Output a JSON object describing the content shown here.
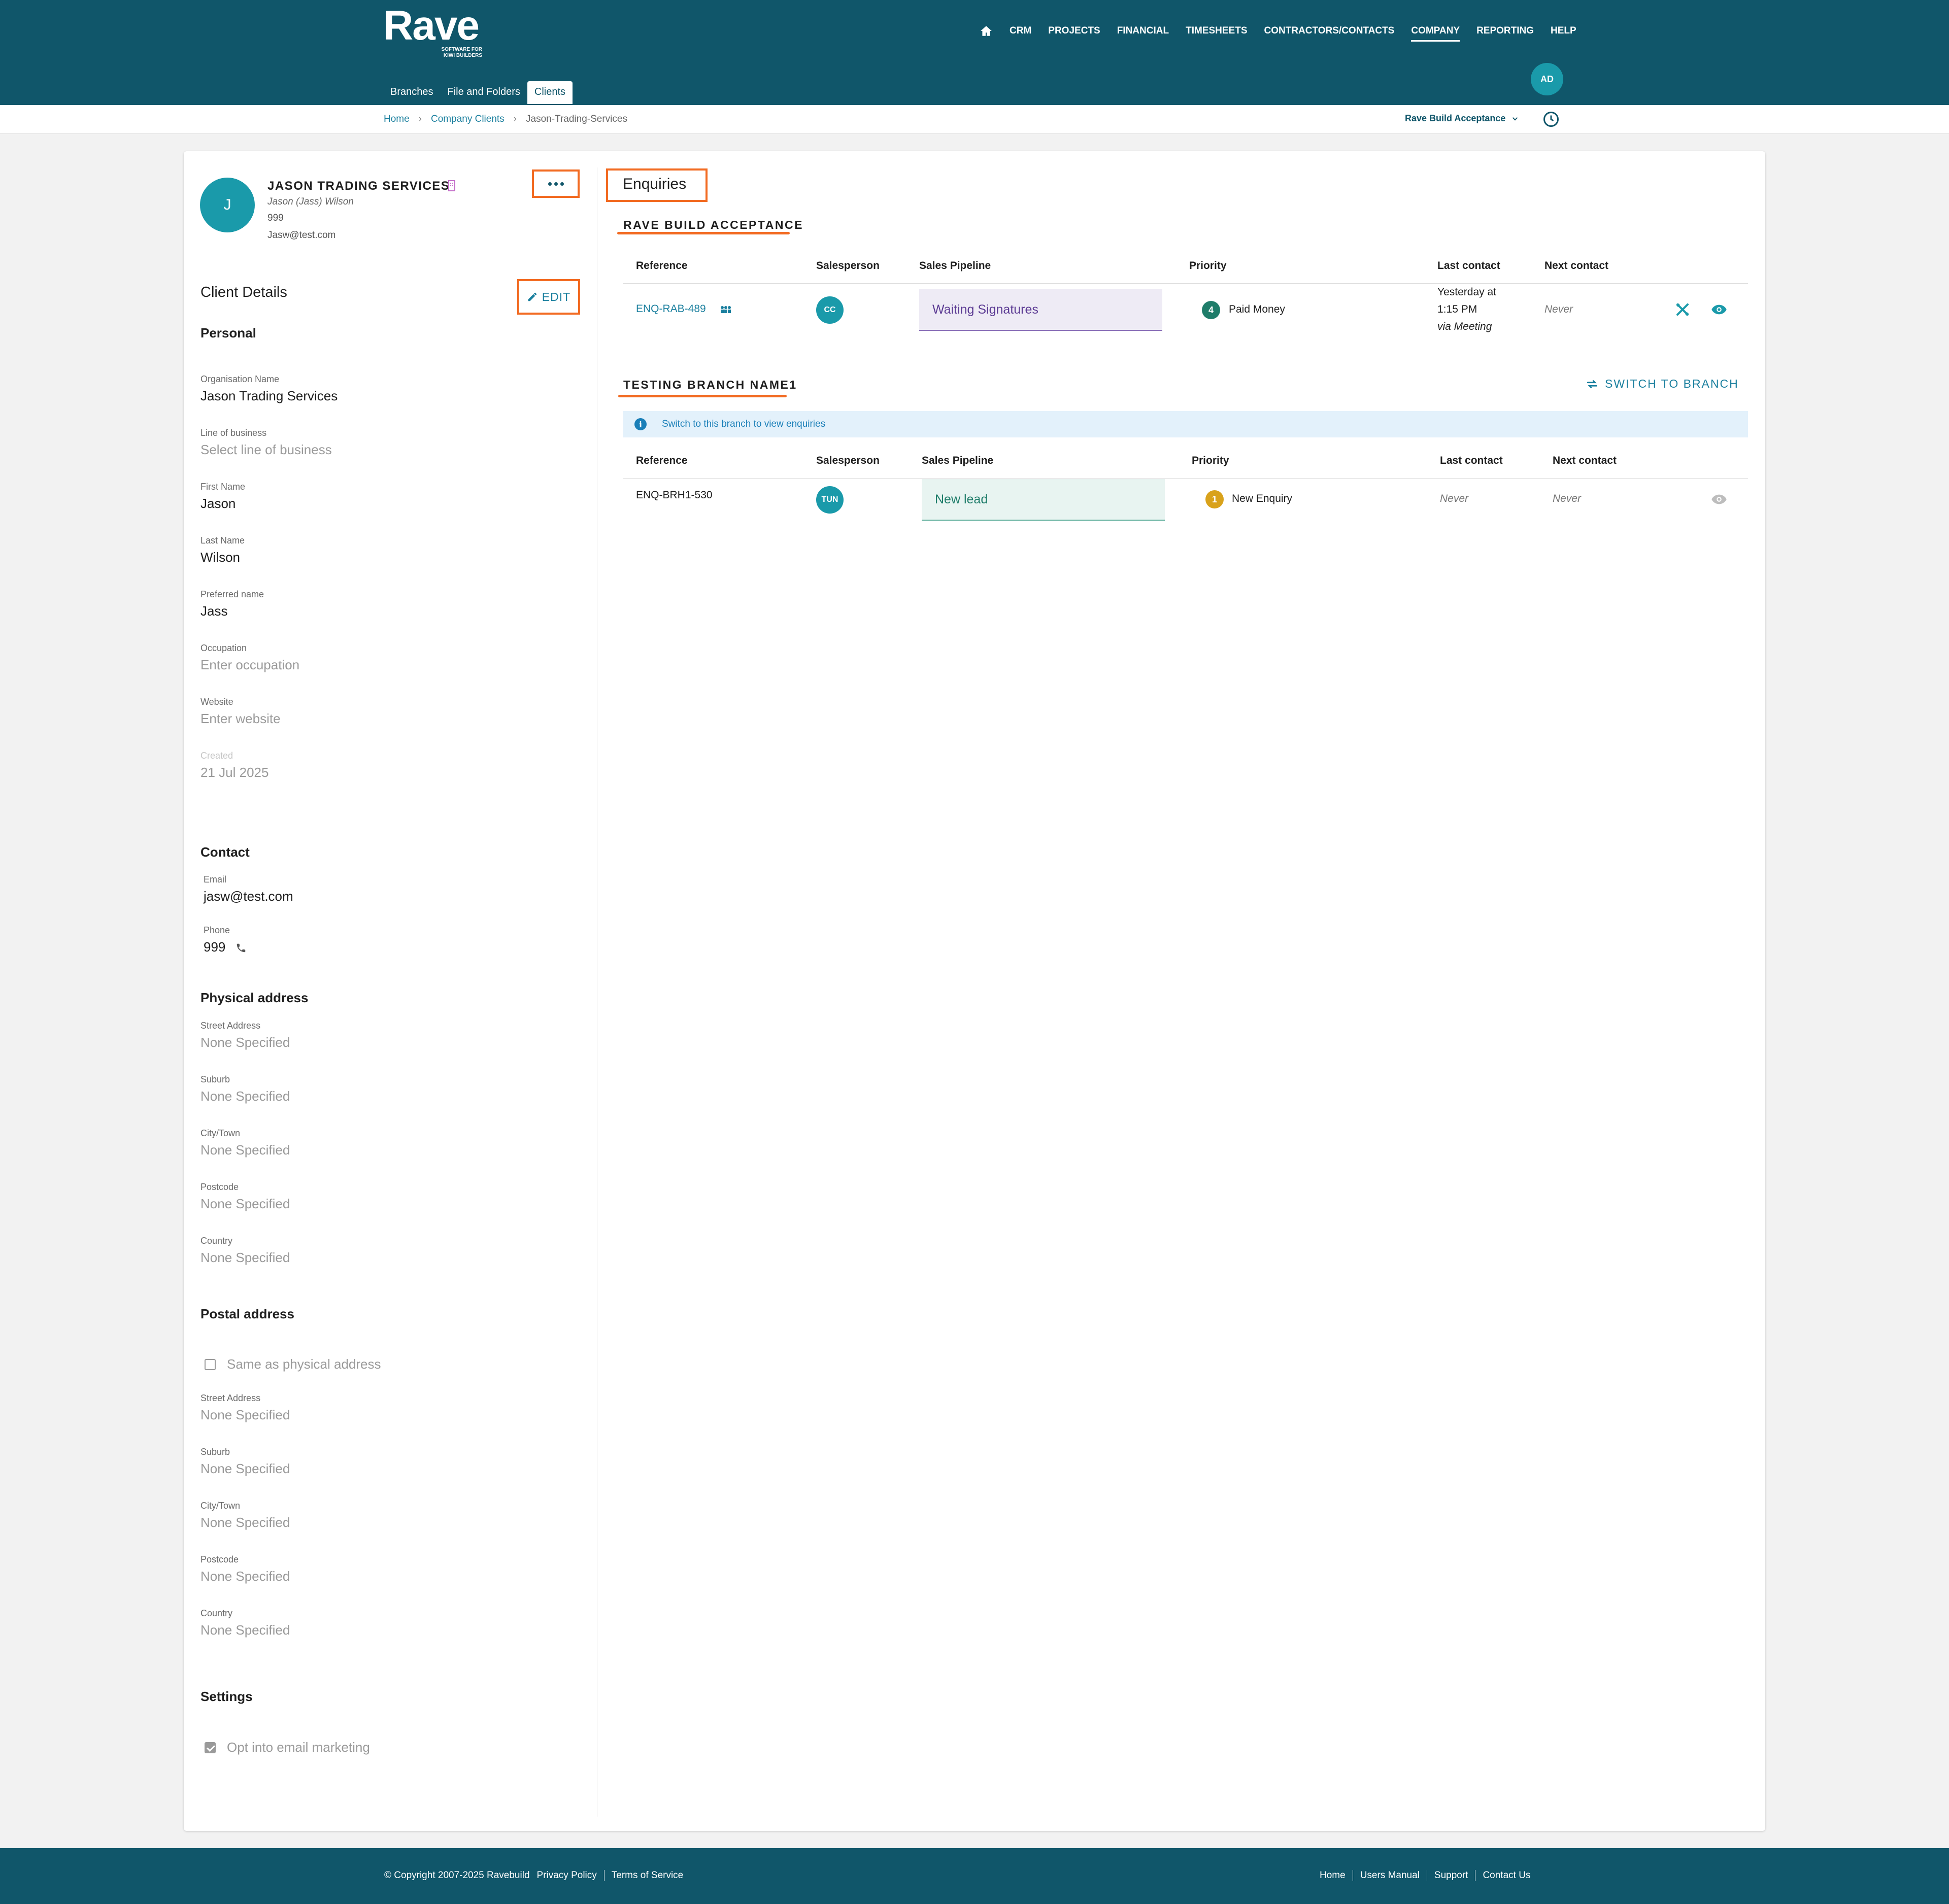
{
  "app": {
    "logo": "Rave",
    "logo_tagline": "SOFTWARE FOR KIWI BUILDERS",
    "user_initials": "AD"
  },
  "nav": {
    "items": [
      "CRM",
      "PROJECTS",
      "FINANCIAL",
      "TIMESHEETS",
      "CONTRACTORS/CONTACTS",
      "COMPANY",
      "REPORTING",
      "HELP"
    ],
    "active": "COMPANY"
  },
  "subtabs": [
    "Branches",
    "File and Folders",
    "Clients"
  ],
  "breadcrumb": [
    "Home",
    "Company Clients",
    "Jason-Trading-Services"
  ],
  "branch_selector": "Rave Build Acceptance",
  "client": {
    "initial": "J",
    "name": "JASON TRADING SERVICES",
    "full_name": "Jason (Jass) Wilson",
    "phone": "999",
    "email": "Jasw@test.com"
  },
  "details": {
    "title": "Client Details",
    "edit_label": "EDIT",
    "personal_title": "Personal",
    "fields": [
      {
        "label": "Organisation Name",
        "value": "Jason Trading Services"
      },
      {
        "label": "Line of business",
        "value": "Select line of business"
      },
      {
        "label": "First Name",
        "value": "Jason"
      },
      {
        "label": "Last Name",
        "value": "Wilson"
      },
      {
        "label": "Preferred name",
        "value": "Jass"
      },
      {
        "label": "Occupation",
        "value": "Enter occupation"
      },
      {
        "label": "Website",
        "value": "Enter website"
      },
      {
        "label": "Created",
        "value": "21 Jul 2025"
      }
    ],
    "contact_title": "Contact",
    "contact": {
      "email_label": "Email",
      "email": "jasw@test.com",
      "phone_label": "Phone",
      "phone": "999"
    },
    "physical_title": "Physical address",
    "physical": [
      {
        "label": "Street Address",
        "value": "None Specified"
      },
      {
        "label": "Suburb",
        "value": "None Specified"
      },
      {
        "label": "City/Town",
        "value": "None Specified"
      },
      {
        "label": "Postcode",
        "value": "None Specified"
      },
      {
        "label": "Country",
        "value": "None Specified"
      }
    ],
    "postal_title": "Postal address",
    "same_as_physical": "Same as physical address",
    "postal": [
      {
        "label": "Street Address",
        "value": "None Specified"
      },
      {
        "label": "Suburb",
        "value": "None Specified"
      },
      {
        "label": "City/Town",
        "value": "None Specified"
      },
      {
        "label": "Postcode",
        "value": "None Specified"
      },
      {
        "label": "Country",
        "value": "None Specified"
      }
    ],
    "settings_title": "Settings",
    "email_marketing": "Opt into email marketing"
  },
  "enquiries": {
    "title": "Enquiries",
    "columns": [
      "Reference",
      "Salesperson",
      "Sales Pipeline",
      "Priority",
      "Last contact",
      "Next contact"
    ],
    "branches": [
      {
        "name": "RAVE BUILD ACCEPTANCE",
        "rows": [
          {
            "reference": "ENQ-RAB-489",
            "salesperson": "CC",
            "pipeline": "Waiting Signatures",
            "priority_num": "4",
            "priority": "Paid Money",
            "last_contact_1": "Yesterday at",
            "last_contact_2": "1:15 PM",
            "last_contact_3": "via Meeting",
            "next_contact": "Never"
          }
        ]
      },
      {
        "name": "TESTING BRANCH NAME1",
        "switch_label": "SWITCH TO BRANCH",
        "info": "Switch to this branch to view enquiries",
        "rows": [
          {
            "reference": "ENQ-BRH1-530",
            "salesperson": "TUN",
            "pipeline": "New lead",
            "priority_num": "1",
            "priority": "New Enquiry",
            "last_contact": "Never",
            "next_contact": "Never"
          }
        ]
      }
    ]
  },
  "footer": {
    "copyright": "© Copyright 2007-2025 Ravebuild",
    "left_links": [
      "Privacy Policy",
      "Terms of Service"
    ],
    "right_links": [
      "Home",
      "Users Manual",
      "Support",
      "Contact Us"
    ]
  },
  "colors": {
    "header": "#10566a",
    "accent": "#1a7f9e",
    "highlight": "#f26b22",
    "priority_4": "#1f7d6a",
    "priority_1": "#d9a21b"
  }
}
